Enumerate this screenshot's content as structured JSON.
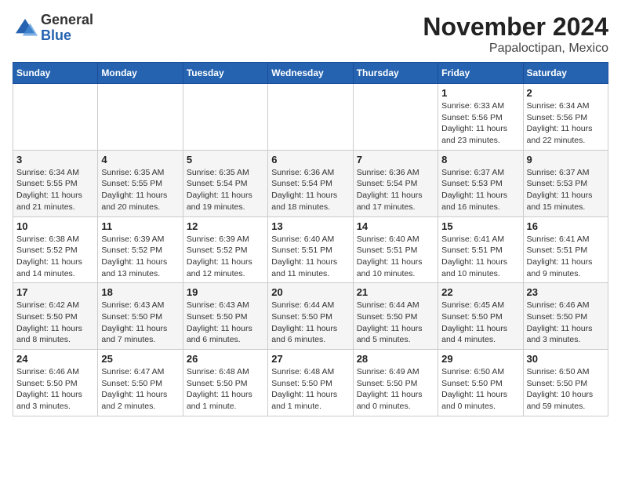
{
  "header": {
    "logo_general": "General",
    "logo_blue": "Blue",
    "month": "November 2024",
    "location": "Papaloctipan, Mexico"
  },
  "weekdays": [
    "Sunday",
    "Monday",
    "Tuesday",
    "Wednesday",
    "Thursday",
    "Friday",
    "Saturday"
  ],
  "weeks": [
    [
      {
        "day": "",
        "info": ""
      },
      {
        "day": "",
        "info": ""
      },
      {
        "day": "",
        "info": ""
      },
      {
        "day": "",
        "info": ""
      },
      {
        "day": "",
        "info": ""
      },
      {
        "day": "1",
        "info": "Sunrise: 6:33 AM\nSunset: 5:56 PM\nDaylight: 11 hours\nand 23 minutes."
      },
      {
        "day": "2",
        "info": "Sunrise: 6:34 AM\nSunset: 5:56 PM\nDaylight: 11 hours\nand 22 minutes."
      }
    ],
    [
      {
        "day": "3",
        "info": "Sunrise: 6:34 AM\nSunset: 5:55 PM\nDaylight: 11 hours\nand 21 minutes."
      },
      {
        "day": "4",
        "info": "Sunrise: 6:35 AM\nSunset: 5:55 PM\nDaylight: 11 hours\nand 20 minutes."
      },
      {
        "day": "5",
        "info": "Sunrise: 6:35 AM\nSunset: 5:54 PM\nDaylight: 11 hours\nand 19 minutes."
      },
      {
        "day": "6",
        "info": "Sunrise: 6:36 AM\nSunset: 5:54 PM\nDaylight: 11 hours\nand 18 minutes."
      },
      {
        "day": "7",
        "info": "Sunrise: 6:36 AM\nSunset: 5:54 PM\nDaylight: 11 hours\nand 17 minutes."
      },
      {
        "day": "8",
        "info": "Sunrise: 6:37 AM\nSunset: 5:53 PM\nDaylight: 11 hours\nand 16 minutes."
      },
      {
        "day": "9",
        "info": "Sunrise: 6:37 AM\nSunset: 5:53 PM\nDaylight: 11 hours\nand 15 minutes."
      }
    ],
    [
      {
        "day": "10",
        "info": "Sunrise: 6:38 AM\nSunset: 5:52 PM\nDaylight: 11 hours\nand 14 minutes."
      },
      {
        "day": "11",
        "info": "Sunrise: 6:39 AM\nSunset: 5:52 PM\nDaylight: 11 hours\nand 13 minutes."
      },
      {
        "day": "12",
        "info": "Sunrise: 6:39 AM\nSunset: 5:52 PM\nDaylight: 11 hours\nand 12 minutes."
      },
      {
        "day": "13",
        "info": "Sunrise: 6:40 AM\nSunset: 5:51 PM\nDaylight: 11 hours\nand 11 minutes."
      },
      {
        "day": "14",
        "info": "Sunrise: 6:40 AM\nSunset: 5:51 PM\nDaylight: 11 hours\nand 10 minutes."
      },
      {
        "day": "15",
        "info": "Sunrise: 6:41 AM\nSunset: 5:51 PM\nDaylight: 11 hours\nand 10 minutes."
      },
      {
        "day": "16",
        "info": "Sunrise: 6:41 AM\nSunset: 5:51 PM\nDaylight: 11 hours\nand 9 minutes."
      }
    ],
    [
      {
        "day": "17",
        "info": "Sunrise: 6:42 AM\nSunset: 5:50 PM\nDaylight: 11 hours\nand 8 minutes."
      },
      {
        "day": "18",
        "info": "Sunrise: 6:43 AM\nSunset: 5:50 PM\nDaylight: 11 hours\nand 7 minutes."
      },
      {
        "day": "19",
        "info": "Sunrise: 6:43 AM\nSunset: 5:50 PM\nDaylight: 11 hours\nand 6 minutes."
      },
      {
        "day": "20",
        "info": "Sunrise: 6:44 AM\nSunset: 5:50 PM\nDaylight: 11 hours\nand 6 minutes."
      },
      {
        "day": "21",
        "info": "Sunrise: 6:44 AM\nSunset: 5:50 PM\nDaylight: 11 hours\nand 5 minutes."
      },
      {
        "day": "22",
        "info": "Sunrise: 6:45 AM\nSunset: 5:50 PM\nDaylight: 11 hours\nand 4 minutes."
      },
      {
        "day": "23",
        "info": "Sunrise: 6:46 AM\nSunset: 5:50 PM\nDaylight: 11 hours\nand 3 minutes."
      }
    ],
    [
      {
        "day": "24",
        "info": "Sunrise: 6:46 AM\nSunset: 5:50 PM\nDaylight: 11 hours\nand 3 minutes."
      },
      {
        "day": "25",
        "info": "Sunrise: 6:47 AM\nSunset: 5:50 PM\nDaylight: 11 hours\nand 2 minutes."
      },
      {
        "day": "26",
        "info": "Sunrise: 6:48 AM\nSunset: 5:50 PM\nDaylight: 11 hours\nand 1 minute."
      },
      {
        "day": "27",
        "info": "Sunrise: 6:48 AM\nSunset: 5:50 PM\nDaylight: 11 hours\nand 1 minute."
      },
      {
        "day": "28",
        "info": "Sunrise: 6:49 AM\nSunset: 5:50 PM\nDaylight: 11 hours\nand 0 minutes."
      },
      {
        "day": "29",
        "info": "Sunrise: 6:50 AM\nSunset: 5:50 PM\nDaylight: 11 hours\nand 0 minutes."
      },
      {
        "day": "30",
        "info": "Sunrise: 6:50 AM\nSunset: 5:50 PM\nDaylight: 10 hours\nand 59 minutes."
      }
    ]
  ]
}
